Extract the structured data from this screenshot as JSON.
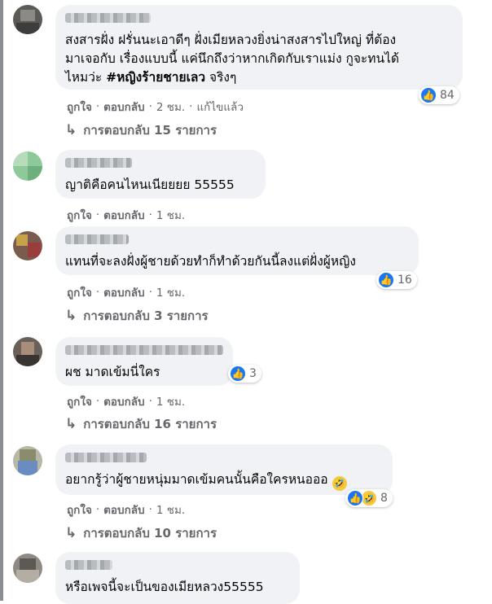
{
  "comments": [
    {
      "name": "",
      "text": "สงสารฝั่ง ฝรั่นนะเอาดีๆ ฝั่งเมียหลวงยิ่งน่าสงสารไปใหญ่ ที่ต้อง\nมาเจอกับ เรื่องแบบนี้ แค่นึกถึงว่าหากเกิดกับเราแม่ง กูจะทนได้\nไหมว่ะ ",
      "hashtag": "#หญิงร้ายชายเลว",
      "text_tail": " จริงๆ",
      "reaction_count": "84",
      "like": "ถูกใจ",
      "reply": "ตอบกลับ",
      "time": "2 ชม.",
      "edited": "แก้ไขแล้ว",
      "replies": "การตอบกลับ 15 รายการ"
    },
    {
      "name": "",
      "text": "ญาติคือคนไหนเนียยยย 55555",
      "like": "ถูกใจ",
      "reply": "ตอบกลับ",
      "time": "1 ชม."
    },
    {
      "name": "",
      "text": "แทนที่จะลงฝั่งผู้ชายด้วยทำก็ทำด้วยกันนี้ลงแต่ฝั่งผู้หญิง",
      "reaction_count": "16",
      "like": "ถูกใจ",
      "reply": "ตอบกลับ",
      "time": "1 ชม.",
      "replies": "การตอบกลับ 3 รายการ"
    },
    {
      "name": "",
      "text": "ผช มาดเข้มนี่ใคร",
      "reaction_count": "3",
      "like": "ถูกใจ",
      "reply": "ตอบกลับ",
      "time": "1 ชม.",
      "replies": "การตอบกลับ 16 รายการ"
    },
    {
      "name": "",
      "text": "อยากรู้ว่าผู้ชายหนุ่มมาดเข้มคนนั้นคือใครหนอออ ",
      "emoji": "🤣",
      "reaction_count": "8",
      "like": "ถูกใจ",
      "reply": "ตอบกลับ",
      "time": "1 ชม.",
      "replies": "การตอบกลับ 10 รายการ"
    },
    {
      "name": "",
      "text": "หรือเพจนี้จะเป็นของเมียหลวง55555"
    }
  ],
  "icons": {
    "like": "thumbs-up-icon",
    "haha": "laughing-face-icon",
    "reply": "reply-arrow-icon"
  },
  "colors": {
    "like_blue": "#1877f2",
    "bubble_bg": "#f0f2f5",
    "meta_gray": "#65676b"
  },
  "separator": "·",
  "reply_arrow": "↳",
  "like_glyph": "👍"
}
